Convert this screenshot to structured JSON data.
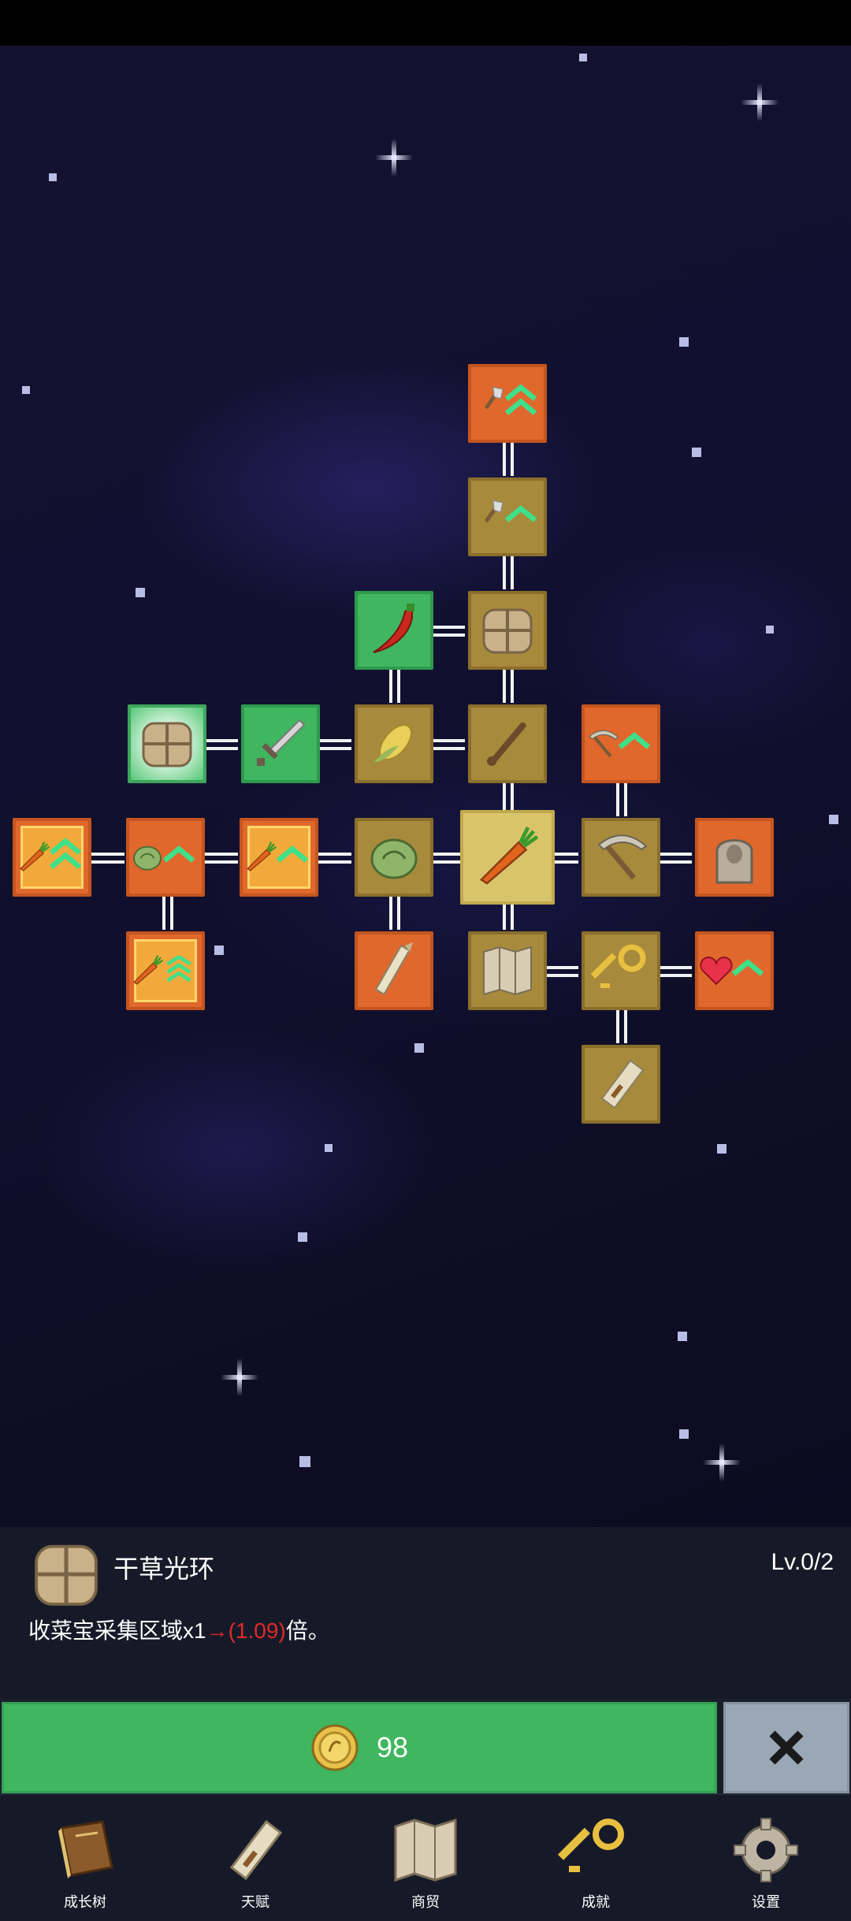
{
  "nodes": [
    {
      "id": "shovel-top",
      "icon": "shovel-icon",
      "color": "orange",
      "chevrons": 2
    },
    {
      "id": "shovel",
      "icon": "shovel-icon",
      "color": "tan",
      "chevrons": 1
    },
    {
      "id": "chili",
      "icon": "chili-pepper-icon",
      "color": "green",
      "chevrons": 0
    },
    {
      "id": "hay-bale",
      "icon": "hay-bale-icon",
      "color": "tan",
      "chevrons": 0
    },
    {
      "id": "hay-bale-glow",
      "icon": "hay-bale-icon",
      "color": "green-glow",
      "chevrons": 0
    },
    {
      "id": "sword",
      "icon": "sword-icon",
      "color": "green",
      "chevrons": 0
    },
    {
      "id": "corn",
      "icon": "corn-icon",
      "color": "tan",
      "chevrons": 0
    },
    {
      "id": "stick",
      "icon": "stick-icon",
      "color": "tan",
      "chevrons": 0
    },
    {
      "id": "pickaxe-top",
      "icon": "pickaxe-icon",
      "color": "orange",
      "chevrons": 1
    },
    {
      "id": "carrot-left",
      "icon": "carrot-icon",
      "color": "gold",
      "chevrons": 2
    },
    {
      "id": "cabbage-left",
      "icon": "cabbage-icon",
      "color": "orange",
      "chevrons": 1
    },
    {
      "id": "carrot-mid",
      "icon": "carrot-icon",
      "color": "gold",
      "chevrons": 1
    },
    {
      "id": "cabbage",
      "icon": "cabbage-icon",
      "color": "tan",
      "chevrons": 0
    },
    {
      "id": "carrot-center",
      "icon": "carrot-icon",
      "color": "selected",
      "chevrons": 0
    },
    {
      "id": "pickaxe",
      "icon": "pickaxe-icon",
      "color": "tan",
      "chevrons": 0
    },
    {
      "id": "ghost",
      "icon": "ghost-statue-icon",
      "color": "orange",
      "chevrons": 0
    },
    {
      "id": "carrot-bottom",
      "icon": "carrot-icon",
      "color": "gold",
      "chevrons": 3
    },
    {
      "id": "leek",
      "icon": "leek-icon",
      "color": "orange",
      "chevrons": 0
    },
    {
      "id": "map",
      "icon": "map-icon",
      "color": "tan",
      "chevrons": 0
    },
    {
      "id": "key",
      "icon": "key-icon",
      "color": "tan",
      "chevrons": 0
    },
    {
      "id": "heart",
      "icon": "heart-icon",
      "color": "orange",
      "chevrons": 1
    },
    {
      "id": "scroll",
      "icon": "scroll-icon",
      "color": "tan",
      "chevrons": 0
    }
  ],
  "panel": {
    "icon": "hay-bale-icon",
    "title": "干草光环",
    "level": "Lv.0/2",
    "desc_prefix": "收菜宝采集区域x1",
    "desc_arrow": "→",
    "desc_new_value": "(1.09)",
    "desc_suffix": "倍。"
  },
  "buy": {
    "coin_icon": "coin-icon",
    "price": "98"
  },
  "close": {
    "icon": "close-icon",
    "label": "✖"
  },
  "nav": [
    {
      "label": "成长树",
      "icon": "book-icon"
    },
    {
      "label": "天赋",
      "icon": "scroll-icon"
    },
    {
      "label": "商贸",
      "icon": "map-icon"
    },
    {
      "label": "成就",
      "icon": "key-icon"
    },
    {
      "label": "设置",
      "icon": "gear-icon"
    }
  ],
  "colors": {
    "orange": "#e0682c",
    "tan": "#a88a3c",
    "green": "#3fb65f",
    "price_red": "#e0282a",
    "panel_bg": "#161a28"
  }
}
